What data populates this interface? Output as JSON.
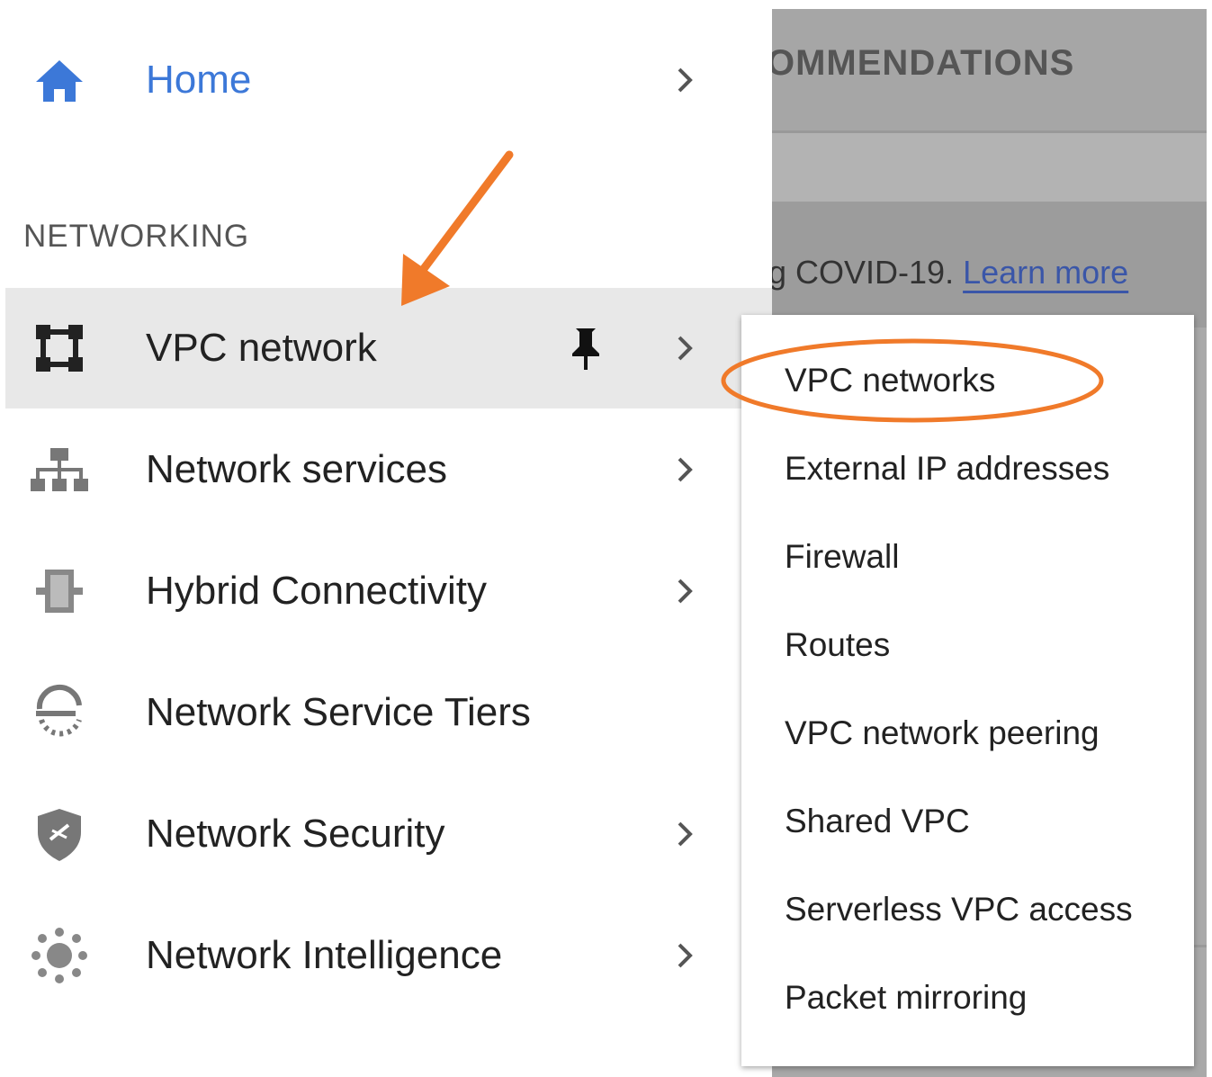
{
  "background": {
    "tab_label": "OMMENDATIONS",
    "banner_text": "g COVID-19.",
    "banner_link": "Learn more"
  },
  "nav": {
    "home_label": "Home",
    "section_heading": "NETWORKING",
    "items": [
      {
        "label": "VPC network",
        "icon": "vpc-network-icon",
        "active": true,
        "pinned": true
      },
      {
        "label": "Network services",
        "icon": "network-services-icon"
      },
      {
        "label": "Hybrid Connectivity",
        "icon": "hybrid-connectivity-icon"
      },
      {
        "label": "Network Service Tiers",
        "icon": "network-service-tiers-icon"
      },
      {
        "label": "Network Security",
        "icon": "network-security-icon"
      },
      {
        "label": "Network Intelligence",
        "icon": "network-intelligence-icon"
      }
    ]
  },
  "submenu": {
    "items": [
      "VPC networks",
      "External IP addresses",
      "Firewall",
      "Routes",
      "VPC network peering",
      "Shared VPC",
      "Serverless VPC access",
      "Packet mirroring"
    ],
    "highlighted": "VPC networks"
  },
  "colors": {
    "home_blue": "#3c78d8",
    "annotation_orange": "#f07a2a",
    "active_row": "#e8e8e8"
  }
}
